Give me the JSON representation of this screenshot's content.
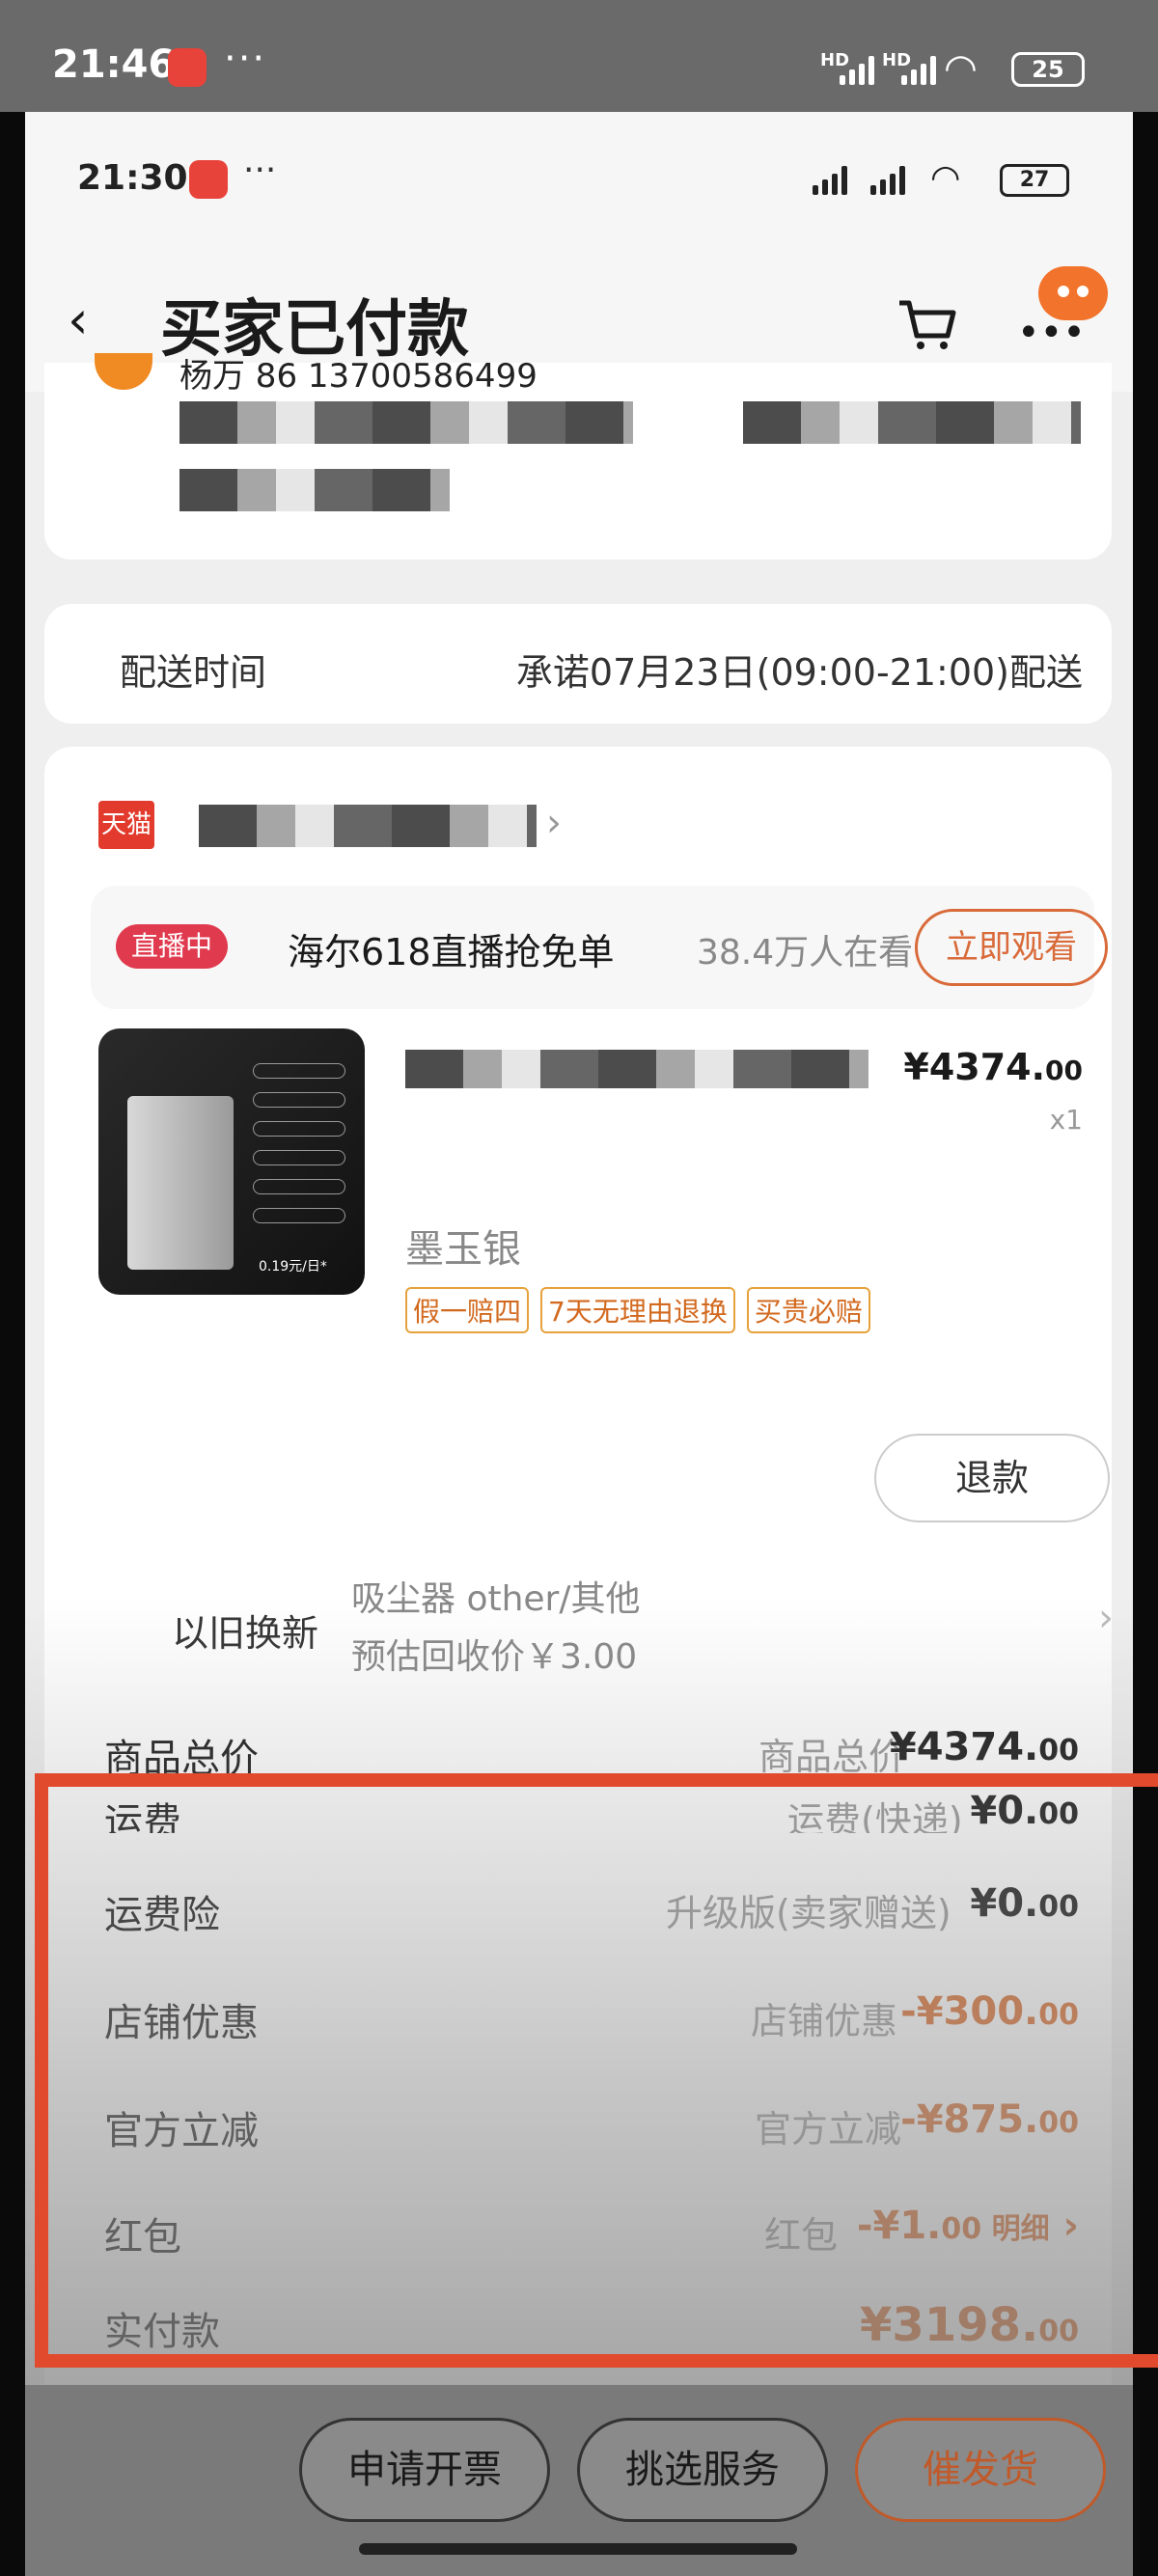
{
  "outer_status": {
    "time": "21:46",
    "signal1": "HD",
    "signal2": "HD",
    "battery": "25"
  },
  "inner_status": {
    "time": "21:30",
    "signal1": "HD",
    "signal2": "HD",
    "battery": "27"
  },
  "nav": {
    "title": "买家已付款",
    "back_icon": "chevron-left-icon",
    "cart_icon": "cart-icon"
  },
  "address": {
    "phone_partial": "杨万 86 13700586499"
  },
  "delivery": {
    "label": "配送时间",
    "value": "承诺07月23日(09:00-21:00)配送"
  },
  "store": {
    "platform": "天猫"
  },
  "live": {
    "tag": "直播中",
    "text": "海尔618直播抢免单",
    "viewers": "38.4万人在看",
    "button": "立即观看"
  },
  "product": {
    "thumb_price": "0.19元/日*",
    "price_main": "¥4374.",
    "price_cents": "00",
    "qty": "x1",
    "color": "墨玉银",
    "badges": [
      "假一赔四",
      "7天无理由退换",
      "买贵必赔"
    ],
    "refund": "退款"
  },
  "tradein": {
    "label": "以旧换新",
    "item": "吸尘器 other/其他",
    "estimate": "预估回收价￥3.00"
  },
  "summary": [
    {
      "label": "商品总价",
      "mid": "商品总价",
      "value": "¥4374.",
      "cents": "00",
      "orange": false
    },
    {
      "label": "运费",
      "mid": "运费(快递)",
      "value": "¥0.",
      "cents": "00",
      "orange": false
    },
    {
      "label": "运费险",
      "mid": "升级版(卖家赠送)",
      "value": "¥0.",
      "cents": "00",
      "orange": false
    },
    {
      "label": "店铺优惠",
      "mid": "店铺优惠",
      "value": "-¥300.",
      "cents": "00",
      "orange": true
    },
    {
      "label": "官方立减",
      "mid": "官方立减",
      "value": "-¥875.",
      "cents": "00",
      "orange": true
    },
    {
      "label": "红包",
      "mid": "红包",
      "value": "-¥1.",
      "cents": "00 明细",
      "orange": true
    },
    {
      "label": "实付款",
      "mid": "",
      "value": "¥3198.",
      "cents": "00",
      "orange": true
    }
  ],
  "actions": {
    "invoice": "申请开票",
    "service": "挑选服务",
    "urge": "催发货"
  },
  "colors": {
    "accent": "#d96a2a",
    "highlight_box": "#e24a2e"
  }
}
